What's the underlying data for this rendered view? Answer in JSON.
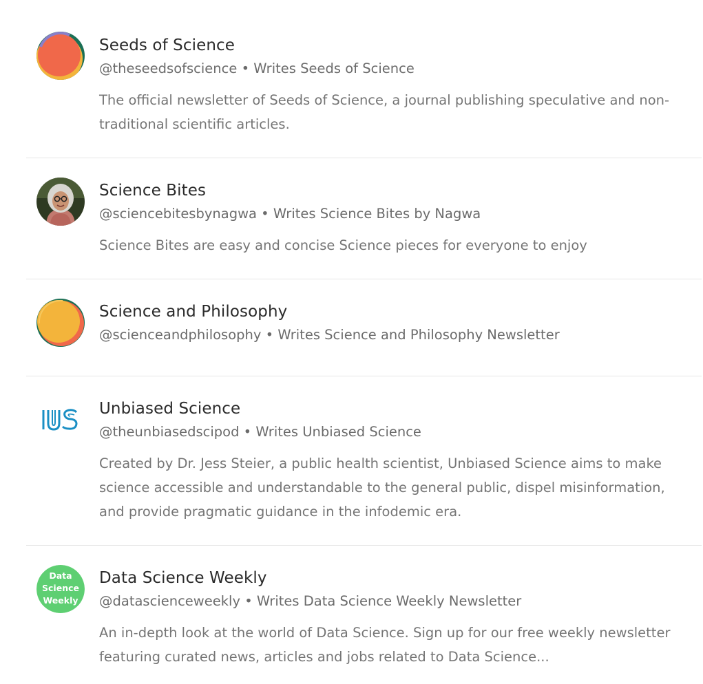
{
  "publications": [
    {
      "name": "Seeds of Science",
      "handle": "@theseedsofscience",
      "separator": " • ",
      "writes": "Writes Seeds of Science",
      "description": "The official newsletter of Seeds of Science, a journal publishing speculative and non-traditional scientific articles.",
      "avatar_icon": "seeds-of-science-logo"
    },
    {
      "name": "Science Bites",
      "handle": "@sciencebitesbynagwa",
      "separator": " • ",
      "writes": "Writes Science Bites by Nagwa",
      "description": "Science Bites are easy and concise Science pieces for everyone to enjoy",
      "avatar_icon": "author-photo"
    },
    {
      "name": "Science and Philosophy",
      "handle": "@scienceandphilosophy",
      "separator": " • ",
      "writes": "Writes Science and Philosophy Newsletter",
      "avatar_icon": "science-and-philosophy-logo"
    },
    {
      "name": "Unbiased Science",
      "handle": "@theunbiasedscipod",
      "separator": " • ",
      "writes": "Writes Unbiased Science",
      "description": "Created by Dr. Jess Steier, a public health scientist, Unbiased Science aims to make science accessible and understandable to the general public, dispel misinformation, and provide pragmatic guidance in the infodemic era.",
      "avatar_icon": "unbiased-science-logo",
      "avatar_accent": "#1a8fc4"
    },
    {
      "name": "Data Science Weekly",
      "handle": "@datascienceweekly",
      "separator": " • ",
      "writes": "Writes Data Science Weekly Newsletter",
      "description": "An in-depth look at the world of Data Science. Sign up for our free weekly newsletter featuring curated news, articles and jobs related to Data Science...",
      "avatar_icon": "data-science-weekly-logo",
      "avatar_text": [
        "Data",
        "Science",
        "Weekly"
      ],
      "avatar_accent": "#5ecf72"
    }
  ]
}
